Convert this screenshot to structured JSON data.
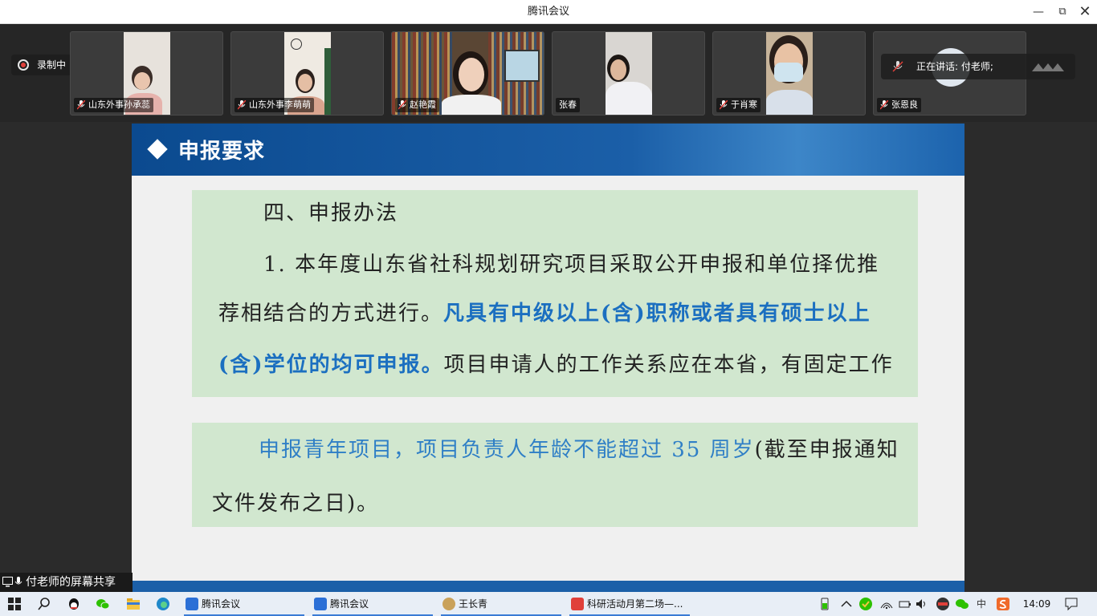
{
  "window": {
    "title": "腾讯会议",
    "min_glyph": "—",
    "max_glyph": "⧉",
    "close_glyph": "✕"
  },
  "recording": {
    "label": "录制中"
  },
  "participants": [
    {
      "name": "山东外事孙承蕊",
      "muted": true
    },
    {
      "name": "山东外事李萌萌",
      "muted": true
    },
    {
      "name": "赵艳霞",
      "muted": true
    },
    {
      "name": "张春",
      "muted": false
    },
    {
      "name": "于肖寒",
      "muted": true
    },
    {
      "name": "张恩良",
      "muted": true
    }
  ],
  "speaking": {
    "label": "正在讲话: 付老师;"
  },
  "slide": {
    "header": "申报要求",
    "section_title": "四、申报办法",
    "para1_line1": "1. 本年度山东省社科规划研究项目采取公开申报和单位择优推",
    "para1_line2_plain": "荐相结合的方式进行。",
    "para1_line2_blue": "凡具有中级以上(含)职称或者具有硕士以上",
    "para1_line3_blue": "(含)学位的均可申报。",
    "para1_line3_plain": "项目申请人的工作关系应在本省，有固定工作",
    "para2_line1_blue": "申报青年项目，项目负责人年龄不能超过 35 周岁",
    "para2_line1_plain": "(截至申报通知",
    "para2_line2": "文件发布之日)。"
  },
  "share_label": "付老师的屏幕共享",
  "taskbar": {
    "apps": [
      {
        "label": "腾讯会议"
      },
      {
        "label": "腾讯会议"
      },
      {
        "label": "王长青"
      },
      {
        "label": "科研活动月第二场—..."
      }
    ],
    "ime": "中",
    "time": "14:09"
  },
  "colors": {
    "accent_blue": "#1b6fc0",
    "slide_header": "#1b5fa8",
    "box_green": "#d1e7cf",
    "record_red": "#e0403a"
  }
}
